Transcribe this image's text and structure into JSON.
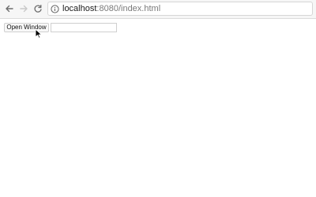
{
  "browser": {
    "back_icon": "arrow-left-icon",
    "forward_icon": "arrow-right-icon",
    "reload_icon": "reload-icon",
    "info_icon": "info-circle-icon",
    "url_host": "localhost",
    "url_path": ":8080/index.html"
  },
  "page": {
    "open_window_label": "Open Window",
    "text_input_value": "",
    "text_input_placeholder": ""
  },
  "cursor": {
    "icon": "mouse-pointer-icon"
  },
  "colors": {
    "toolbar_background": "#f6f6f6",
    "page_background": "#ffffff",
    "address_host": "#1a1a1a",
    "address_path": "#7a7a7a"
  }
}
